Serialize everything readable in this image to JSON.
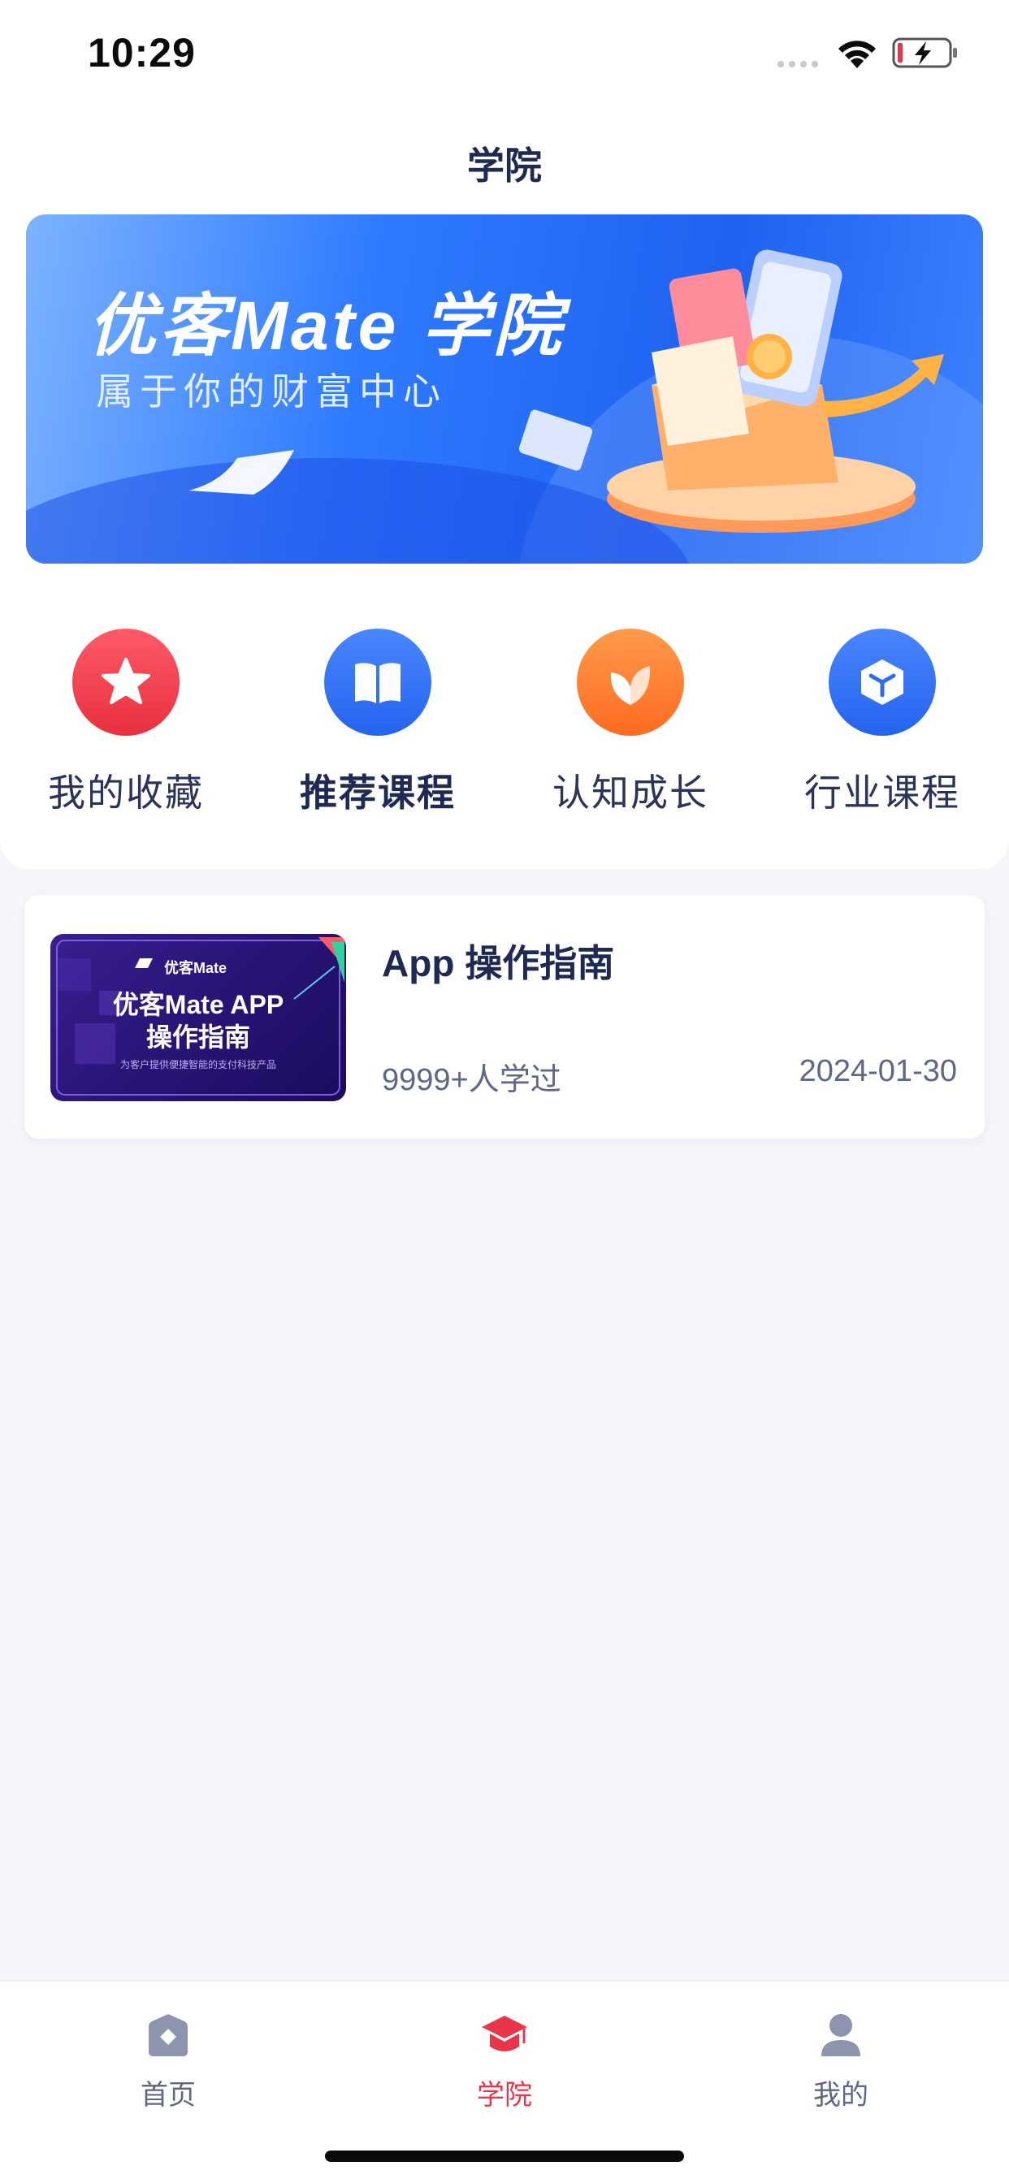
{
  "status_bar": {
    "time": "10:29"
  },
  "header": {
    "title": "学院"
  },
  "banner": {
    "title": "优客Mate 学院",
    "subtitle": "属于你的财富中心"
  },
  "quick_nav": [
    {
      "label": "我的收藏",
      "icon": "star-icon",
      "color": "#EE3A4B"
    },
    {
      "label": "推荐课程",
      "icon": "book-icon",
      "color": "#2E6FF2"
    },
    {
      "label": "认知成长",
      "icon": "leaf-icon",
      "color": "#FF7E2E"
    },
    {
      "label": "行业课程",
      "icon": "cube-icon",
      "color": "#2E6FF2"
    }
  ],
  "course": {
    "thumbnail": {
      "brand": "优客Mate",
      "title_line1": "优客Mate APP",
      "title_line2": "操作指南",
      "caption": "为客户提供便捷智能的支付科技产品"
    },
    "title": "App 操作指南",
    "learners": "9999+人学过",
    "date": "2024-01-30"
  },
  "tab_bar": {
    "tabs": [
      {
        "label": "首页",
        "icon": "home-icon",
        "active": false
      },
      {
        "label": "学院",
        "icon": "graduation-cap-icon",
        "active": true
      },
      {
        "label": "我的",
        "icon": "user-icon",
        "active": false
      }
    ],
    "active_color": "#E8354A",
    "inactive_color": "#5E6784"
  }
}
